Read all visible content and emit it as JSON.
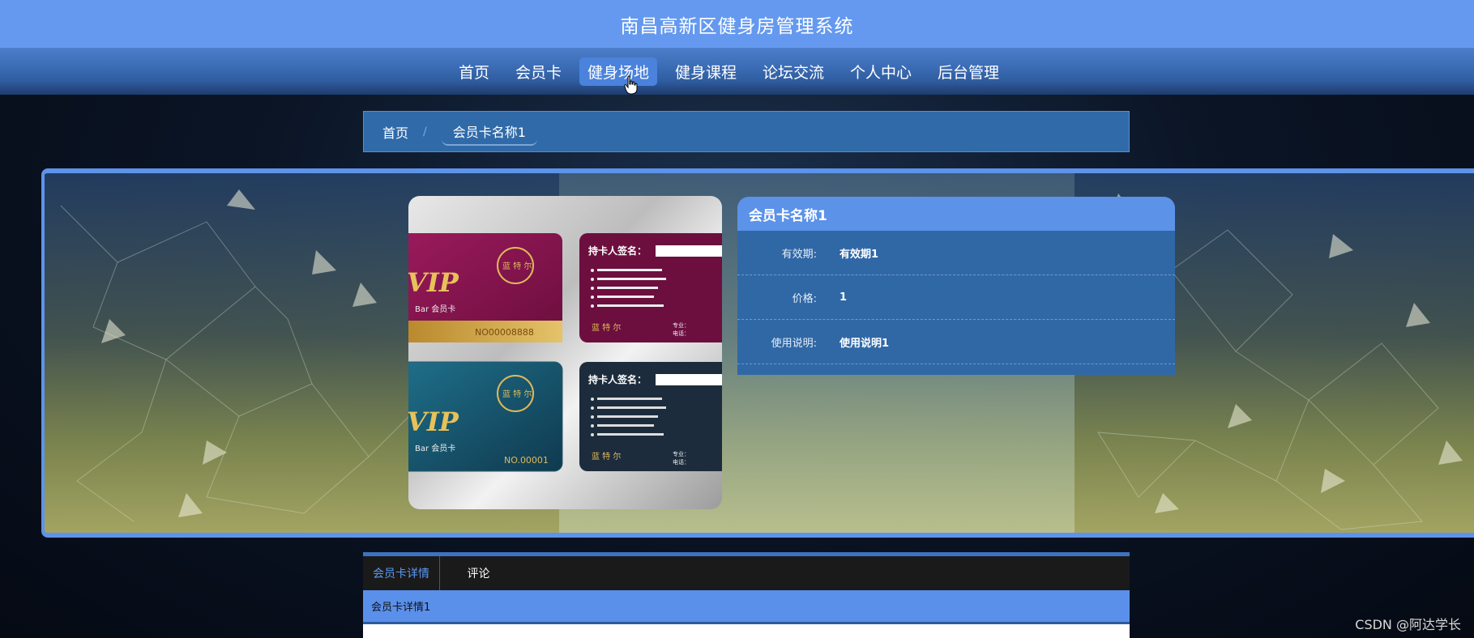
{
  "header": {
    "title": "南昌高新区健身房管理系统"
  },
  "nav": {
    "items": [
      {
        "label": "首页",
        "active": false
      },
      {
        "label": "会员卡",
        "active": false
      },
      {
        "label": "健身场地",
        "active": true
      },
      {
        "label": "健身课程",
        "active": false
      },
      {
        "label": "论坛交流",
        "active": false
      },
      {
        "label": "个人中心",
        "active": false
      },
      {
        "label": "后台管理",
        "active": false
      }
    ]
  },
  "breadcrumb": {
    "home": "首页",
    "separator": "/",
    "current": "会员卡名称1"
  },
  "card_image": {
    "card1": {
      "signature": "持卡人签名：",
      "vip": "VIP",
      "type": "Bar 会员卡",
      "number": "NO00008888",
      "brand": "蓝 特 尔",
      "footer_a": "专业：",
      "footer_b": "电话："
    },
    "card2": {
      "signature": "持卡人签名：",
      "vip": "VIP",
      "type": "Bar 会员卡",
      "number": "NO.00001",
      "brand": "蓝 特 尔",
      "footer_a": "专业：",
      "footer_b": "电话："
    }
  },
  "info": {
    "title": "会员卡名称1",
    "rows": [
      {
        "label": "有效期:",
        "value": "有效期1"
      },
      {
        "label": "价格:",
        "value": "1"
      },
      {
        "label": "使用说明:",
        "value": "使用说明1"
      }
    ]
  },
  "tabs": {
    "detail": "会员卡详情",
    "comment": "评论",
    "content": "会员卡详情1"
  },
  "watermark": "CSDN @阿达学长",
  "colors": {
    "header_bg": "#6499ef",
    "nav_active": "#4a82dc",
    "panel_bg": "#3068a6",
    "panel_title": "#5c92e8",
    "tab_active_text": "#5b9af2"
  }
}
